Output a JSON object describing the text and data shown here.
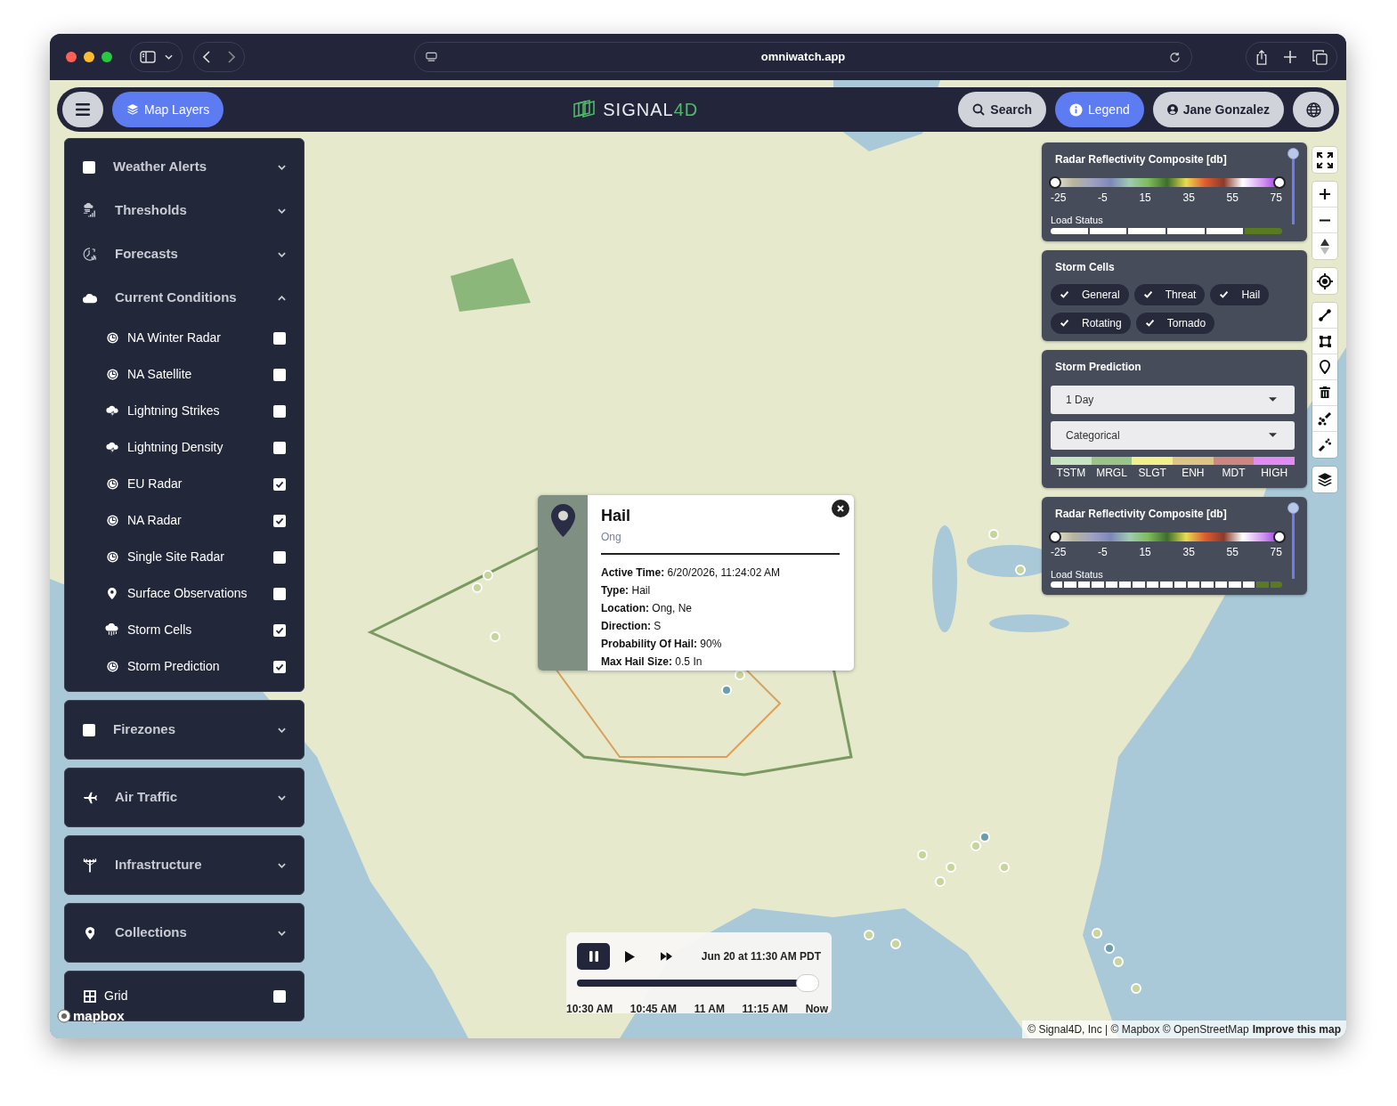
{
  "browser": {
    "url": "omniwatch.app"
  },
  "header": {
    "map_layers": "Map Layers",
    "logo": "SIGNAL",
    "logo_accent": "4D",
    "search": "Search",
    "legend": "Legend",
    "user": "Jane Gonzalez"
  },
  "sidebar": {
    "panels": [
      {
        "sections": [
          {
            "label": "Weather Alerts",
            "kind": "checkable",
            "checked": false,
            "expanded": false
          },
          {
            "label": "Thresholds",
            "kind": "group",
            "expanded": false
          },
          {
            "label": "Forecasts",
            "kind": "group",
            "expanded": false
          },
          {
            "label": "Current Conditions",
            "kind": "group",
            "expanded": true,
            "children": [
              {
                "label": "NA Winter Radar",
                "checked": false
              },
              {
                "label": "NA Satellite",
                "checked": false
              },
              {
                "label": "Lightning Strikes",
                "checked": false
              },
              {
                "label": "Lightning Density",
                "checked": false
              },
              {
                "label": "EU Radar",
                "checked": true
              },
              {
                "label": "NA Radar",
                "checked": true
              },
              {
                "label": "Single Site Radar",
                "checked": false
              },
              {
                "label": "Surface Observations",
                "checked": false
              },
              {
                "label": "Storm Cells",
                "checked": true
              },
              {
                "label": "Storm Prediction",
                "checked": true
              }
            ]
          }
        ]
      },
      {
        "sections": [
          {
            "label": "Firezones",
            "kind": "checkable",
            "checked": false,
            "expanded": false
          }
        ]
      },
      {
        "sections": [
          {
            "label": "Air Traffic",
            "kind": "group",
            "expanded": false
          }
        ]
      },
      {
        "sections": [
          {
            "label": "Infrastructure",
            "kind": "group",
            "expanded": false
          }
        ]
      },
      {
        "sections": [
          {
            "label": "Collections",
            "kind": "group",
            "expanded": false
          }
        ]
      },
      {
        "sections": [
          {
            "label": "Grid",
            "kind": "toggle",
            "checked": false
          }
        ]
      }
    ]
  },
  "legends": [
    {
      "kind": "colorbar",
      "title": "Radar Reflectivity Composite [db]",
      "ticks": [
        "-25",
        "-5",
        "15",
        "35",
        "55",
        "75"
      ],
      "load_label": "Load Status",
      "segments": [
        {
          "loaded": false
        },
        {
          "loaded": false
        },
        {
          "loaded": false
        },
        {
          "loaded": false
        },
        {
          "loaded": false
        },
        {
          "loaded": true
        }
      ],
      "opacity": {
        "level": 1
      }
    },
    {
      "kind": "chips",
      "title": "Storm Cells",
      "chips": [
        {
          "label": "General",
          "checked": true
        },
        {
          "label": "Threat",
          "checked": true
        },
        {
          "label": "Hail",
          "checked": true
        },
        {
          "label": "Rotating",
          "checked": true
        },
        {
          "label": "Tornado",
          "checked": true
        }
      ]
    },
    {
      "kind": "prediction",
      "title": "Storm Prediction",
      "selects": [
        {
          "value": "1 Day"
        },
        {
          "value": "Categorical"
        }
      ],
      "categories": [
        {
          "label": "TSTM",
          "color": "#c8e3c2"
        },
        {
          "label": "MRGL",
          "color": "#9cc488"
        },
        {
          "label": "SLGT",
          "color": "#f2f08c"
        },
        {
          "label": "ENH",
          "color": "#dcc486"
        },
        {
          "label": "MDT",
          "color": "#cc8880"
        },
        {
          "label": "HIGH",
          "color": "#e08cf2"
        }
      ]
    },
    {
      "kind": "colorbar",
      "title": "Radar Reflectivity Composite [db]",
      "ticks": [
        "-25",
        "-5",
        "15",
        "35",
        "55",
        "75"
      ],
      "load_label": "Load Status",
      "segments": [
        {
          "loaded": false
        },
        {
          "loaded": false
        },
        {
          "loaded": false
        },
        {
          "loaded": false
        },
        {
          "loaded": false
        },
        {
          "loaded": false
        },
        {
          "loaded": false
        },
        {
          "loaded": false
        },
        {
          "loaded": false
        },
        {
          "loaded": false
        },
        {
          "loaded": false
        },
        {
          "loaded": false
        },
        {
          "loaded": false
        },
        {
          "loaded": false
        },
        {
          "loaded": false
        },
        {
          "loaded": true
        },
        {
          "loaded": true
        }
      ],
      "opacity": {
        "level": 1
      }
    }
  ],
  "popup": {
    "title": "Hail",
    "subtitle": "Ong",
    "lines": [
      "**Active Time:** 6/20/2026, 11:24:02 AM",
      "**Type:** Hail",
      "**Location:** Ong, Ne",
      "**Direction:** S",
      "**Probability Of Hail:** 90%",
      "**Max Hail Size:** 0.5 In"
    ]
  },
  "timeline": {
    "playing": true,
    "timestamp": "Jun 20 at 11:30 AM PDT",
    "level": 1,
    "ticks": [
      "10:30 AM",
      "10:45 AM",
      "11 AM",
      "11:15 AM",
      "Now"
    ]
  },
  "attribution": {
    "text": "© Signal4D, Inc | © Mapbox © OpenStreetMap",
    "link": "Improve this map"
  },
  "map_logo": "mapbox"
}
